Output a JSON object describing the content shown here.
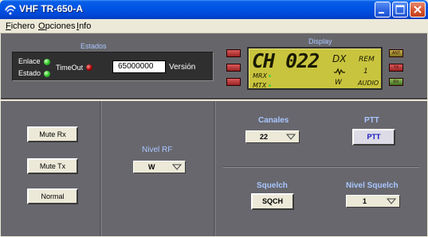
{
  "window": {
    "title": "VHF TR-650-A",
    "controls": {
      "minimize_icon": "minimize-icon",
      "maximize_icon": "maximize-icon",
      "close_icon": "close-icon"
    }
  },
  "menu": {
    "items": [
      {
        "label": "Fichero",
        "accel": "F"
      },
      {
        "label": "Opciones",
        "accel": "O"
      },
      {
        "label": "Info",
        "accel": "I"
      }
    ]
  },
  "estados": {
    "title": "Estados",
    "enlace_label": "Enlace",
    "estado_label": "Estado",
    "timeout_label": "TimeOut",
    "version_value": "65000000",
    "version_label": "Versión"
  },
  "display": {
    "title": "Display",
    "left_leds": [
      "",
      "",
      ""
    ],
    "right_leds": [
      "ANT",
      "TX",
      "RX"
    ],
    "channel": "CH 022",
    "mrx": "MRX",
    "mtx": "MTX",
    "dx": "DX",
    "rem": "REM",
    "one": "1",
    "w": "W",
    "audio": "AUDIO"
  },
  "left_panel": {
    "mute_rx": "Mute Rx",
    "mute_tx": "Mute Tx",
    "normal": "Normal"
  },
  "mid_panel": {
    "nivel_rf_label": "Nivel RF",
    "nivel_rf_value": "W"
  },
  "right_panel": {
    "canales_label": "Canales",
    "canales_value": "22",
    "ptt_label": "PTT",
    "ptt_button": "PTT",
    "squelch_label": "Squelch",
    "sqch_button": "SQCH",
    "nivel_squelch_label": "Nivel Squelch",
    "nivel_squelch_value": "1"
  },
  "colors": {
    "titlebar": "#0055e5",
    "panel_bg": "#67676d",
    "label_blue": "#a9c6ff",
    "lcd": "#c9c43e",
    "led_green": "#3cd033",
    "led_red": "#a50000"
  }
}
